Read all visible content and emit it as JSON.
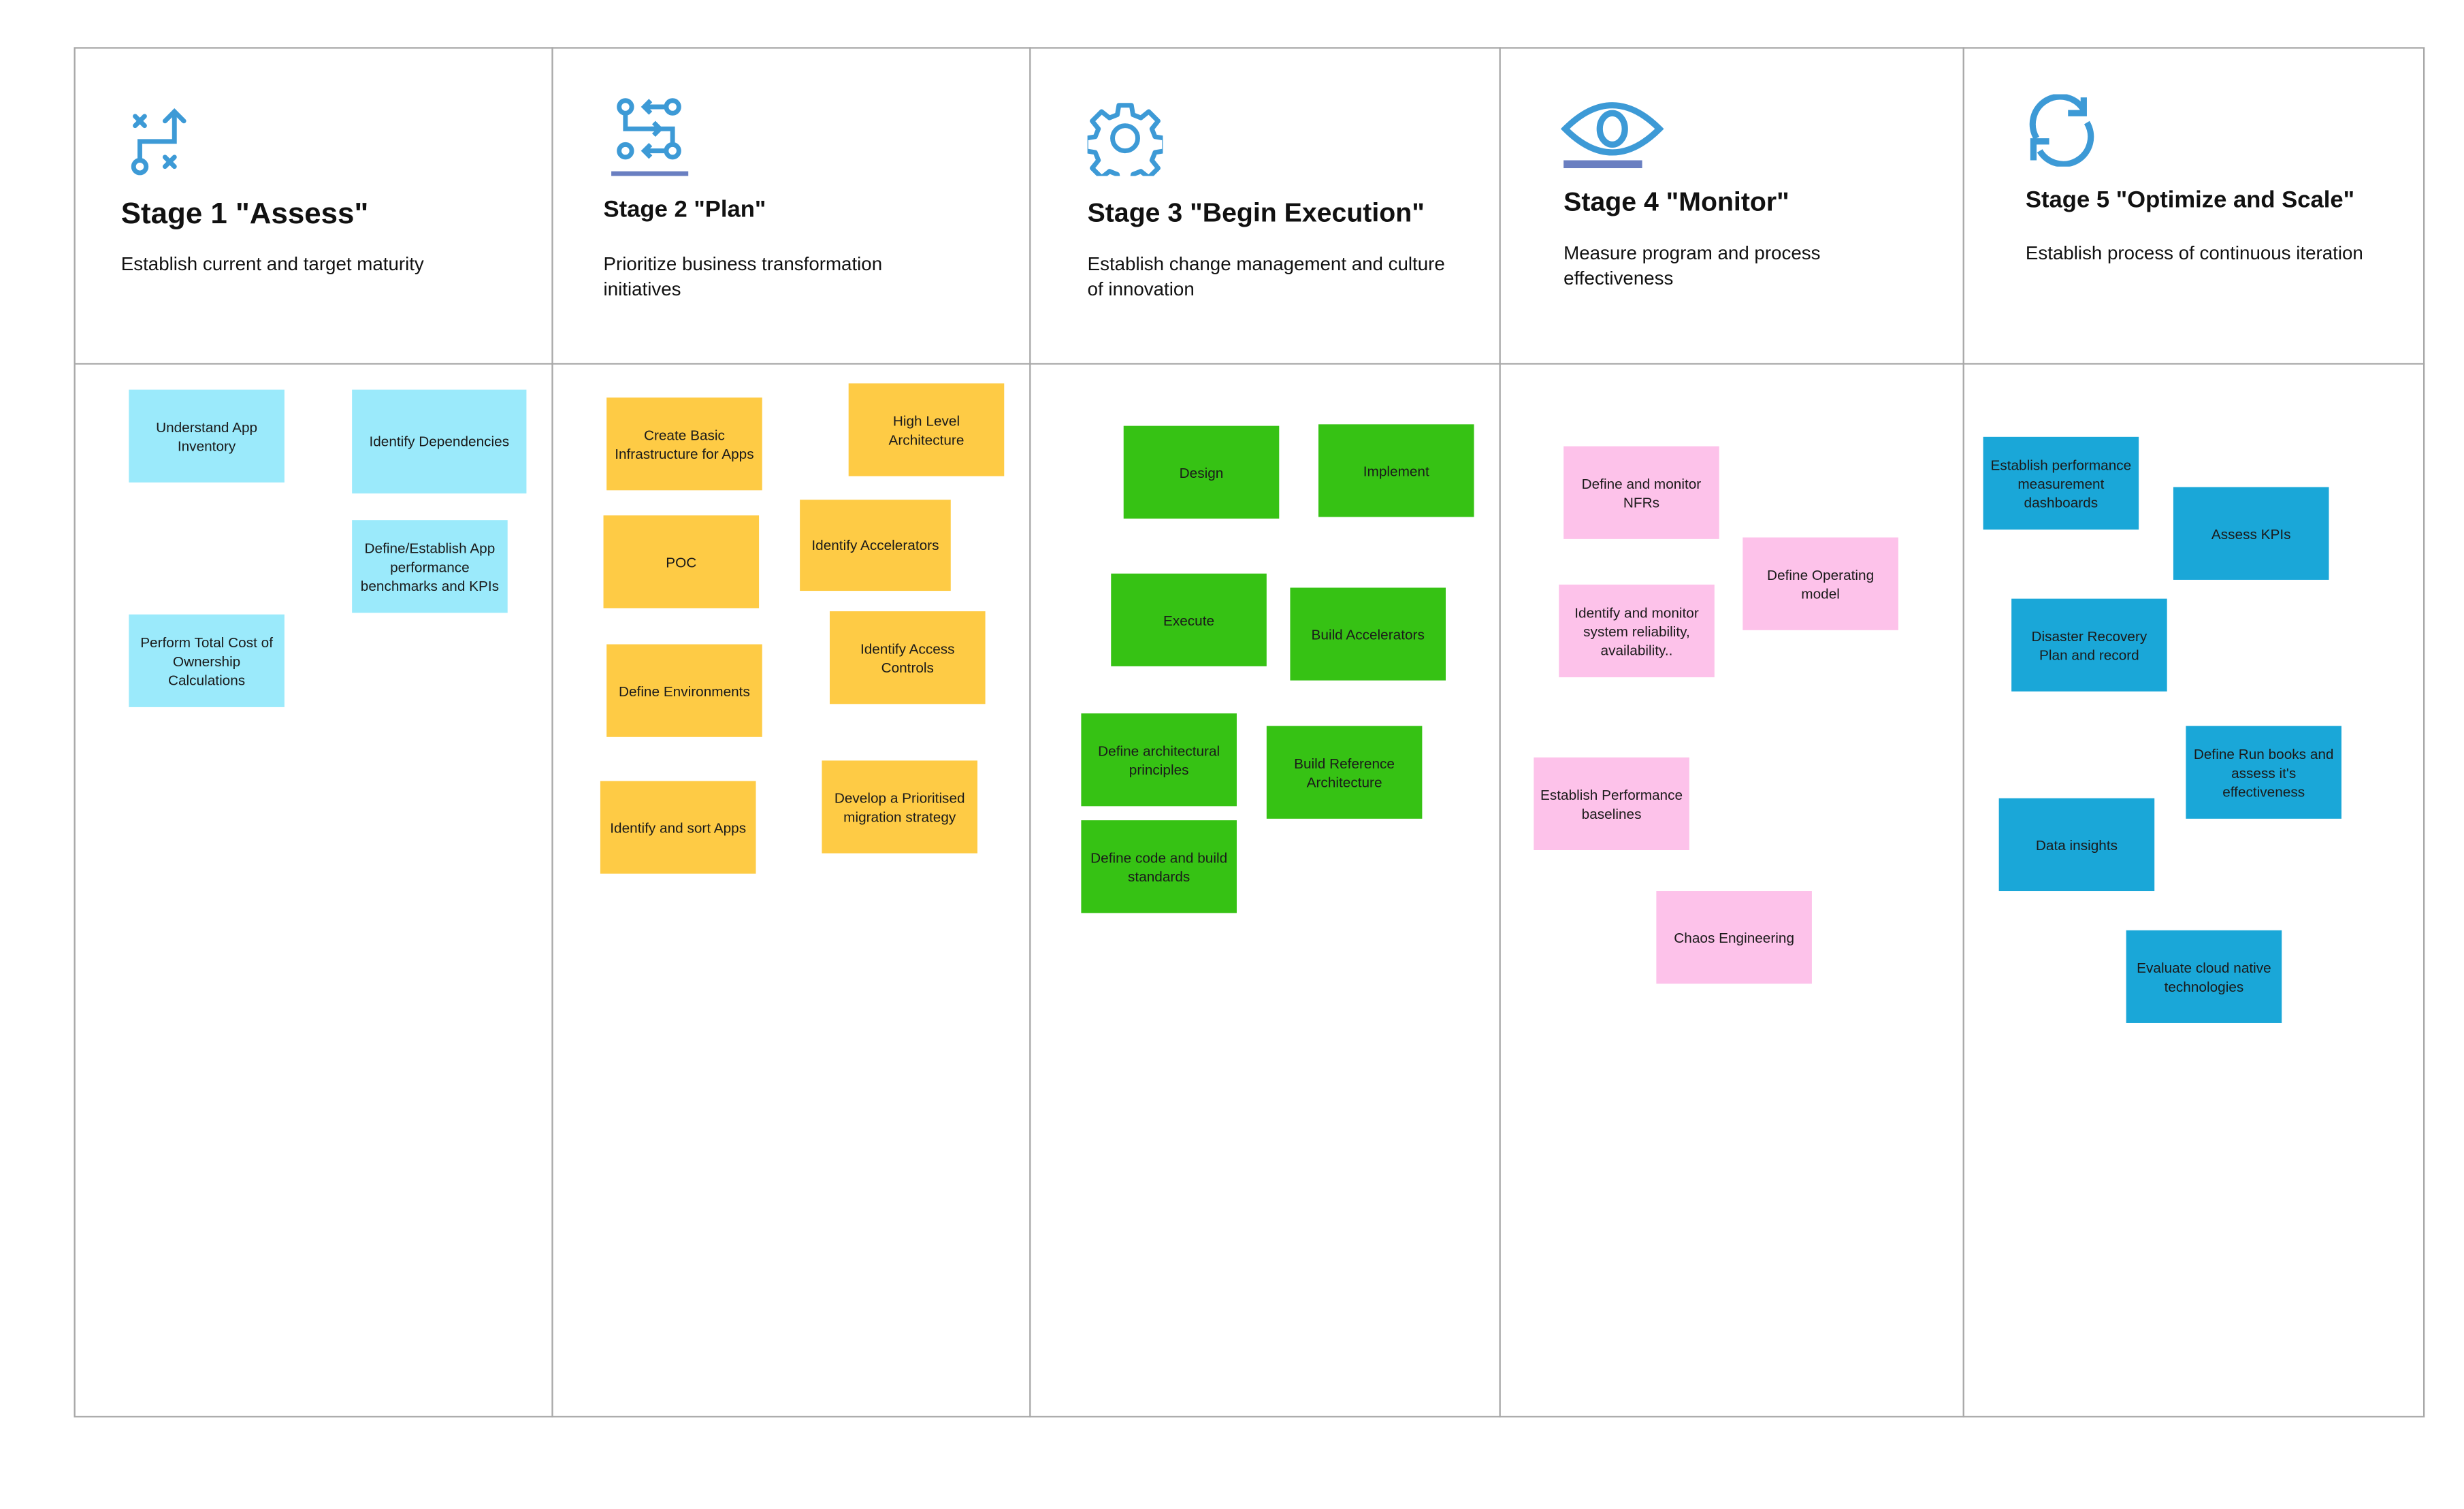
{
  "colors": {
    "icon": "#3d9ad6",
    "stage1_note": "#9beafb",
    "stage2_note": "#fecb45",
    "stage3_note": "#36c214",
    "stage4_note": "#fdc2ea",
    "stage5_note": "#1aa7d8"
  },
  "stages": [
    {
      "title": "Stage 1 \"Assess\"",
      "description": "Establish current and target maturity",
      "icon": "strategy-path-icon",
      "notes": [
        "Understand App Inventory",
        "Identify Dependencies",
        "Define/Establish App performance benchmarks and KPIs",
        "Perform Total Cost of Ownership Calculations"
      ]
    },
    {
      "title": "Stage 2 \"Plan\"",
      "description": "Prioritize business transformation initiatives",
      "icon": "workflow-icon",
      "notes": [
        "Create Basic Infrastructure for Apps",
        "High Level Architecture",
        "POC",
        "Identify Accelerators",
        "Identify Access Controls",
        "Define Environments",
        "Identify and sort Apps",
        "Develop a Prioritised migration strategy"
      ]
    },
    {
      "title": "Stage 3 \"Begin Execution\"",
      "description": "Establish change management and culture of innovation",
      "icon": "gear-icon",
      "notes": [
        "Design",
        "Implement",
        "Execute",
        "Build Accelerators",
        "Define architectural principles",
        "Build Reference Architecture",
        "Define code and build standards"
      ]
    },
    {
      "title": "Stage 4 \"Monitor\"",
      "description": "Measure program and process effectiveness",
      "icon": "eye-icon",
      "notes": [
        "Define and monitor NFRs",
        "Define Operating model",
        "Identify and monitor system reliability, availability..",
        "Establish Performance baselines",
        "Chaos Engineering"
      ]
    },
    {
      "title": "Stage 5 \"Optimize and Scale\"",
      "description": "Establish process of continuous iteration",
      "icon": "refresh-icon",
      "notes": [
        "Establish performance measurement dashboards",
        "Assess KPIs",
        "Disaster Recovery Plan and record",
        "Define Run books and assess it's effectiveness",
        "Data insights",
        "Evaluate cloud native technologies"
      ]
    }
  ]
}
